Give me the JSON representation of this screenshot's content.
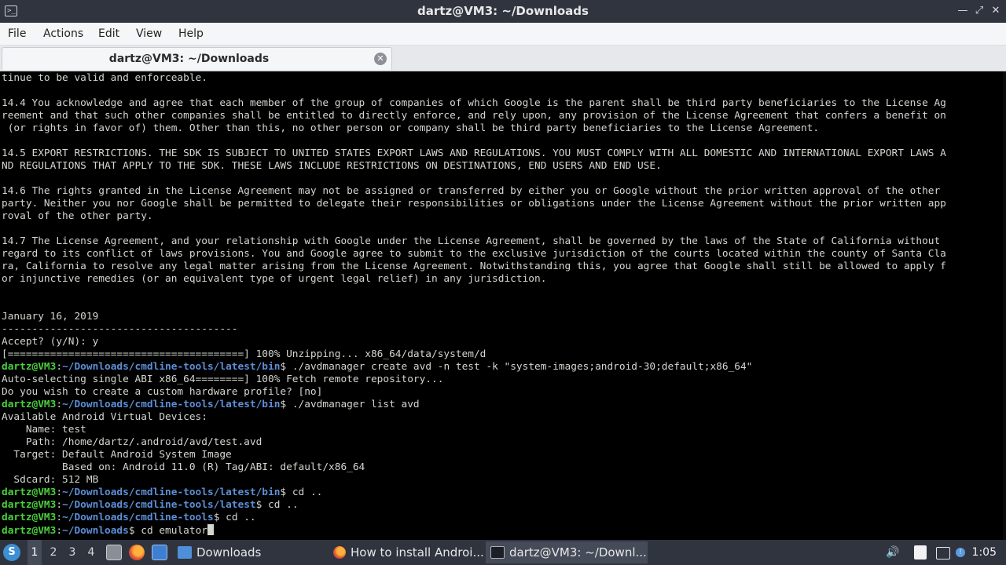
{
  "window": {
    "title": "dartz@VM3: ~/Downloads",
    "app_icon": ">_"
  },
  "window_controls": {
    "minimize": "—",
    "maximize": "⤢",
    "close": "✕"
  },
  "menubar": {
    "items": [
      "File",
      "Actions",
      "Edit",
      "View",
      "Help"
    ]
  },
  "tab": {
    "label": "dartz@VM3: ~/Downloads",
    "close_icon": "✕"
  },
  "terminal": {
    "prompt_user": "dartz@VM3",
    "lines": [
      {
        "t": "text",
        "text": "tinue to be valid and enforceable."
      },
      {
        "t": "text",
        "text": ""
      },
      {
        "t": "text",
        "text": "14.4 You acknowledge and agree that each member of the group of companies of which Google is the parent shall be third party beneficiaries to the License Ag"
      },
      {
        "t": "text",
        "text": "reement and that such other companies shall be entitled to directly enforce, and rely upon, any provision of the License Agreement that confers a benefit on"
      },
      {
        "t": "text",
        "text": " (or rights in favor of) them. Other than this, no other person or company shall be third party beneficiaries to the License Agreement."
      },
      {
        "t": "text",
        "text": ""
      },
      {
        "t": "text",
        "text": "14.5 EXPORT RESTRICTIONS. THE SDK IS SUBJECT TO UNITED STATES EXPORT LAWS AND REGULATIONS. YOU MUST COMPLY WITH ALL DOMESTIC AND INTERNATIONAL EXPORT LAWS A"
      },
      {
        "t": "text",
        "text": "ND REGULATIONS THAT APPLY TO THE SDK. THESE LAWS INCLUDE RESTRICTIONS ON DESTINATIONS, END USERS AND END USE."
      },
      {
        "t": "text",
        "text": ""
      },
      {
        "t": "text",
        "text": "14.6 The rights granted in the License Agreement may not be assigned or transferred by either you or Google without the prior written approval of the other"
      },
      {
        "t": "text",
        "text": "party. Neither you nor Google shall be permitted to delegate their responsibilities or obligations under the License Agreement without the prior written app"
      },
      {
        "t": "text",
        "text": "roval of the other party."
      },
      {
        "t": "text",
        "text": ""
      },
      {
        "t": "text",
        "text": "14.7 The License Agreement, and your relationship with Google under the License Agreement, shall be governed by the laws of the State of California without"
      },
      {
        "t": "text",
        "text": "regard to its conflict of laws provisions. You and Google agree to submit to the exclusive jurisdiction of the courts located within the county of Santa Cla"
      },
      {
        "t": "text",
        "text": "ra, California to resolve any legal matter arising from the License Agreement. Notwithstanding this, you agree that Google shall still be allowed to apply f"
      },
      {
        "t": "text",
        "text": "or injunctive remedies (or an equivalent type of urgent legal relief) in any jurisdiction."
      },
      {
        "t": "text",
        "text": ""
      },
      {
        "t": "text",
        "text": ""
      },
      {
        "t": "text",
        "text": "January 16, 2019"
      },
      {
        "t": "text",
        "text": "---------------------------------------"
      },
      {
        "t": "text",
        "text": "Accept? (y/N): y"
      },
      {
        "t": "text",
        "text": "[=======================================] 100% Unzipping... x86_64/data/system/d"
      },
      {
        "t": "prompt",
        "path": "~/Downloads/cmdline-tools/latest/bin",
        "cmd": " ./avdmanager create avd -n test -k \"system-images;android-30;default;x86_64\""
      },
      {
        "t": "text",
        "text": "Auto-selecting single ABI x86_64========] 100% Fetch remote repository..."
      },
      {
        "t": "text",
        "text": "Do you wish to create a custom hardware profile? [no]"
      },
      {
        "t": "prompt",
        "path": "~/Downloads/cmdline-tools/latest/bin",
        "cmd": " ./avdmanager list avd"
      },
      {
        "t": "text",
        "text": "Available Android Virtual Devices:"
      },
      {
        "t": "text",
        "text": "    Name: test"
      },
      {
        "t": "text",
        "text": "    Path: /home/dartz/.android/avd/test.avd"
      },
      {
        "t": "text",
        "text": "  Target: Default Android System Image"
      },
      {
        "t": "text",
        "text": "          Based on: Android 11.0 (R) Tag/ABI: default/x86_64"
      },
      {
        "t": "text",
        "text": "  Sdcard: 512 MB"
      },
      {
        "t": "prompt",
        "path": "~/Downloads/cmdline-tools/latest/bin",
        "cmd": " cd .."
      },
      {
        "t": "prompt",
        "path": "~/Downloads/cmdline-tools/latest",
        "cmd": " cd .."
      },
      {
        "t": "prompt",
        "path": "~/Downloads/cmdline-tools",
        "cmd": " cd .."
      },
      {
        "t": "prompt",
        "path": "~/Downloads",
        "cmd": " cd emulator",
        "cursor": true
      }
    ]
  },
  "taskbar": {
    "start_icon": "start-menu-icon",
    "workspaces": [
      "1",
      "2",
      "3",
      "4"
    ],
    "active_workspace": "1",
    "tasks": [
      {
        "label": "Downloads",
        "icon": "folder-icon"
      },
      {
        "label": "How to install Androi...",
        "icon": "firefox-icon"
      },
      {
        "label": "dartz@VM3: ~/Downl...",
        "icon": "terminal-icon"
      }
    ],
    "clock": "1:05",
    "colors": {
      "panel": "#2f343f",
      "prompt_user": "#4ad13c",
      "prompt_path": "#5c8fd6"
    }
  }
}
